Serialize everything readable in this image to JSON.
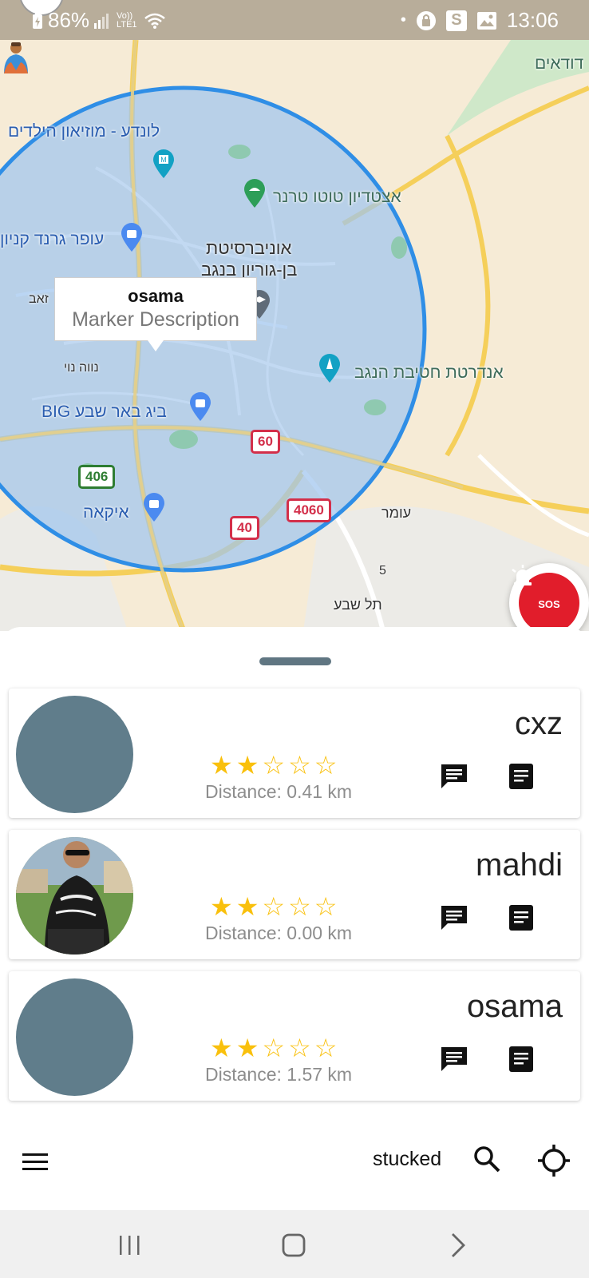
{
  "status_bar": {
    "battery": "86%",
    "volte": "Vo)) LTE1",
    "dot": "•",
    "s_badge": "S",
    "time": "13:06"
  },
  "map": {
    "labels": {
      "top_right": "דודאים",
      "museum": "לונדע - מוזיאון הילדים",
      "totto": "אצטדיון טוטו טרנר",
      "ofer": "עופר גרנד קניון",
      "university_1": "אוניברסיטת",
      "university_2": "בן-גוריון בנגב",
      "zeev": "זאב",
      "neve_noy": "נווה נוי",
      "andarta": "אנדרטת חטיבת הנגב",
      "big": "ביג באר שבע BIG",
      "ikea": "איקאה",
      "omer": "עומר",
      "tel_sheva": "תל שבע",
      "five": "5"
    },
    "road_shields": {
      "r60": "60",
      "r406": "406",
      "r4060": "4060",
      "r40": "40"
    },
    "info_window": {
      "title": "osama",
      "description": "Marker Description"
    },
    "sos_label": "SOS",
    "colors": {
      "circle_stroke": "#2f8ee6",
      "circle_fill": "#9fc5ee",
      "sos": "#e11d2b"
    }
  },
  "sheet": {
    "cards": [
      {
        "name": "cxz",
        "rating": 2,
        "max_rating": 5,
        "distance": "Distance: 0.41 km",
        "has_photo": false
      },
      {
        "name": "mahdi",
        "rating": 2,
        "max_rating": 5,
        "distance": "Distance: 0.00 km",
        "has_photo": true
      },
      {
        "name": "osama",
        "rating": 2,
        "max_rating": 5,
        "distance": "Distance: 1.57 km",
        "has_photo": false
      }
    ],
    "icons": {
      "chat": "chat-icon",
      "details": "details-icon"
    }
  },
  "bottom_bar": {
    "status_text": "stucked",
    "menu_icon": "menu-icon",
    "search_icon": "search-icon",
    "locate_icon": "my-location-icon"
  },
  "system_nav": {
    "recents": "recents-icon",
    "home": "home-icon",
    "back": "back-icon"
  }
}
